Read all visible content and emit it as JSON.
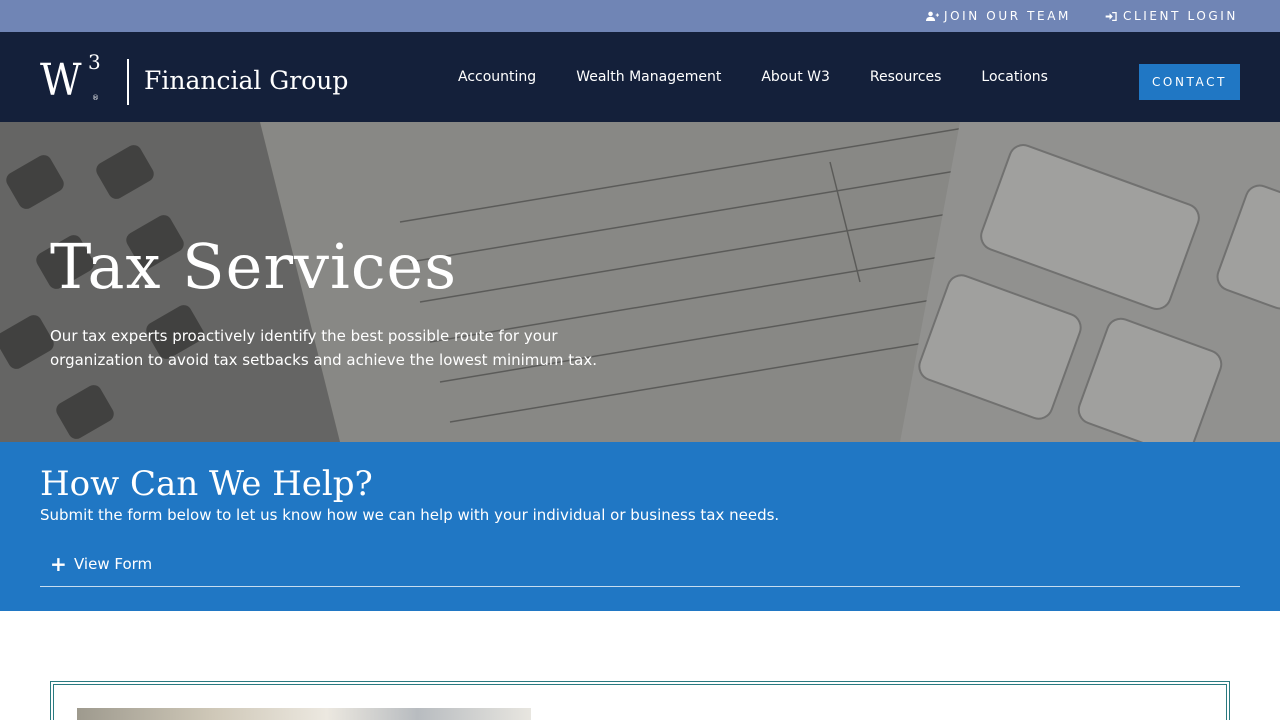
{
  "utility": {
    "join_label": "JOIN OUR TEAM",
    "join_icon": "user-plus-icon",
    "login_label": "CLIENT LOGIN",
    "login_icon": "sign-in-icon"
  },
  "header": {
    "logo_mark": "W",
    "logo_sup": "3",
    "logo_reg": "®",
    "logo_text": "Financial Group",
    "nav": [
      "Accounting",
      "Wealth Management",
      "About W3",
      "Resources",
      "Locations"
    ],
    "contact_label": "CONTACT"
  },
  "hero": {
    "title": "Tax Services",
    "description": "Our tax experts proactively identify the best possible route for your organization to avoid tax setbacks and achieve the lowest minimum tax."
  },
  "help": {
    "title": "How Can We Help?",
    "subtitle": "Submit the form below to let us know how we can help with your individual or business tax needs.",
    "toggle_label": "View Form",
    "toggle_icon": "plus-icon"
  },
  "colors": {
    "utility_bar": "#7085b5",
    "header": "#14203a",
    "accent": "#2077c4",
    "card_border": "#2a7a80"
  }
}
